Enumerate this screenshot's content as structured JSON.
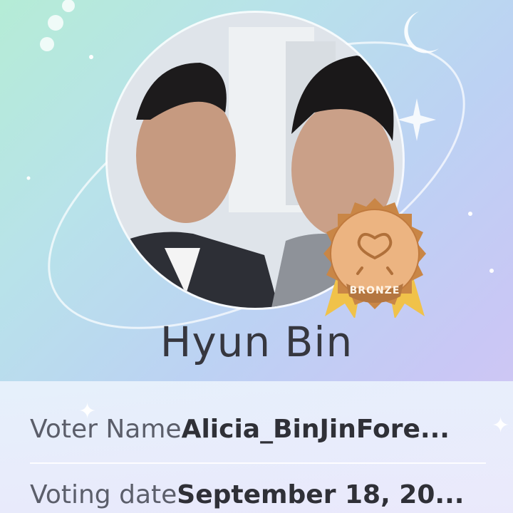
{
  "idol": {
    "name": "Hyun Bin"
  },
  "badge": {
    "tier_label": "BRONZE",
    "color": "#d4925a"
  },
  "voter": {
    "label": "Voter Name",
    "value": "Alicia_BinJinFore..."
  },
  "voting": {
    "label": "Voting date",
    "value": "September 18, 20..."
  },
  "colors": {
    "card_bg": "#eaf2fc",
    "name_text": "#36373f",
    "badge_ribbon": "#f0c24a"
  }
}
